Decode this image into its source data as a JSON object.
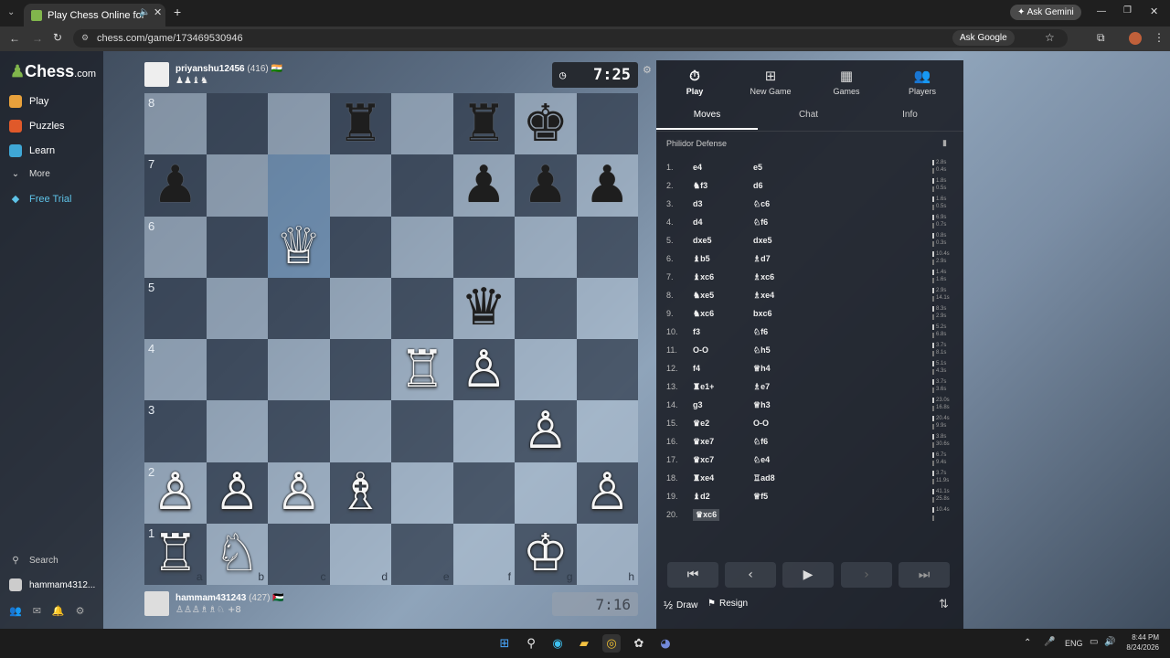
{
  "browser": {
    "tab_title": "Play Chess Online for FREE",
    "url": "chess.com/game/173469530946",
    "ask_gemini": "Ask Gemini",
    "ask_google": "Ask Google"
  },
  "sidebar": {
    "logo": "Chess",
    "logo_suffix": ".com",
    "items": [
      {
        "label": "Play",
        "color": "#e8a13c"
      },
      {
        "label": "Puzzles",
        "color": "#e0592a"
      },
      {
        "label": "Learn",
        "color": "#3fa7d6"
      },
      {
        "label": "More",
        "color": "#aaaaaa"
      },
      {
        "label": "Free Trial",
        "color": "#5ec3e8"
      }
    ],
    "search": "Search",
    "user": "hammam4312..."
  },
  "top_player": {
    "name": "priyanshu12456",
    "rating": "(416)",
    "clock": "7:25"
  },
  "bottom_player": {
    "name": "hammam431243",
    "rating": "(427)",
    "captured_extra": "+8",
    "clock": "7:16"
  },
  "board": {
    "ranks": [
      "8",
      "7",
      "6",
      "5",
      "4",
      "3",
      "2",
      "1"
    ],
    "files": [
      "a",
      "b",
      "c",
      "d",
      "e",
      "f",
      "g",
      "h"
    ],
    "rows": [
      [
        "",
        "",
        "",
        "♜",
        "",
        "♜",
        "♚",
        ""
      ],
      [
        "♟",
        "",
        "",
        "",
        "",
        "♟",
        "♟",
        "♟"
      ],
      [
        "",
        "",
        "♕",
        "",
        "",
        "",
        "",
        ""
      ],
      [
        "",
        "",
        "",
        "",
        "",
        "♛",
        "",
        ""
      ],
      [
        "",
        "",
        "",
        "",
        "♖",
        "♙",
        "",
        ""
      ],
      [
        "",
        "",
        "",
        "",
        "",
        "",
        "♙",
        ""
      ],
      [
        "♙",
        "♙",
        "♙",
        "♗",
        "",
        "",
        "",
        "♙"
      ],
      [
        "♖",
        "♘",
        "",
        "",
        "",
        "",
        "♔",
        ""
      ]
    ]
  },
  "panel": {
    "tabs": [
      "Play",
      "New Game",
      "Games",
      "Players"
    ],
    "subtabs": [
      "Moves",
      "Chat",
      "Info"
    ],
    "opening": "Philidor Defense",
    "moves": [
      {
        "n": "1.",
        "w": "e4",
        "b": "e5",
        "tw": "2.8s",
        "tb": "0.4s"
      },
      {
        "n": "2.",
        "w": "♞f3",
        "b": "d6",
        "tw": "1.8s",
        "tb": "0.5s"
      },
      {
        "n": "3.",
        "w": "d3",
        "b": "♘c6",
        "tw": "1.6s",
        "tb": "0.5s"
      },
      {
        "n": "4.",
        "w": "d4",
        "b": "♘f6",
        "tw": "6.9s",
        "tb": "0.7s"
      },
      {
        "n": "5.",
        "w": "dxe5",
        "b": "dxe5",
        "tw": "0.8s",
        "tb": "0.3s"
      },
      {
        "n": "6.",
        "w": "♝b5",
        "b": "♗d7",
        "tw": "10.4s",
        "tb": "2.9s"
      },
      {
        "n": "7.",
        "w": "♝xc6",
        "b": "♗xc6",
        "tw": "1.4s",
        "tb": "1.6s"
      },
      {
        "n": "8.",
        "w": "♞xe5",
        "b": "♗xe4",
        "tw": "2.9s",
        "tb": "14.1s"
      },
      {
        "n": "9.",
        "w": "♞xc6",
        "b": "bxc6",
        "tw": "8.3s",
        "tb": "2.9s"
      },
      {
        "n": "10.",
        "w": "f3",
        "b": "♘f6",
        "tw": "5.2s",
        "tb": "6.8s"
      },
      {
        "n": "11.",
        "w": "O-O",
        "b": "♘h5",
        "tw": "3.7s",
        "tb": "8.1s"
      },
      {
        "n": "12.",
        "w": "f4",
        "b": "♕h4",
        "tw": "5.1s",
        "tb": "4.3s"
      },
      {
        "n": "13.",
        "w": "♜e1+",
        "b": "♗e7",
        "tw": "3.7s",
        "tb": "3.6s"
      },
      {
        "n": "14.",
        "w": "g3",
        "b": "♕h3",
        "tw": "23.0s",
        "tb": "16.8s"
      },
      {
        "n": "15.",
        "w": "♛e2",
        "b": "O-O",
        "tw": "20.4s",
        "tb": "9.9s"
      },
      {
        "n": "16.",
        "w": "♛xe7",
        "b": "♘f6",
        "tw": "3.8s",
        "tb": "30.6s"
      },
      {
        "n": "17.",
        "w": "♛xc7",
        "b": "♘e4",
        "tw": "6.7s",
        "tb": "9.4s"
      },
      {
        "n": "18.",
        "w": "♜xe4",
        "b": "♖ad8",
        "tw": "3.7s",
        "tb": "11.9s"
      },
      {
        "n": "19.",
        "w": "♝d2",
        "b": "♕f5",
        "tw": "41.1s",
        "tb": "25.8s"
      },
      {
        "n": "20.",
        "w": "♛xc6",
        "b": "",
        "tw": "10.4s",
        "tb": ""
      }
    ],
    "draw": "Draw",
    "draw_prefix": "½",
    "resign": "Resign"
  },
  "taskbar": {
    "lang": "ENG",
    "time": "8:44 PM",
    "date": "8/24/2026"
  }
}
